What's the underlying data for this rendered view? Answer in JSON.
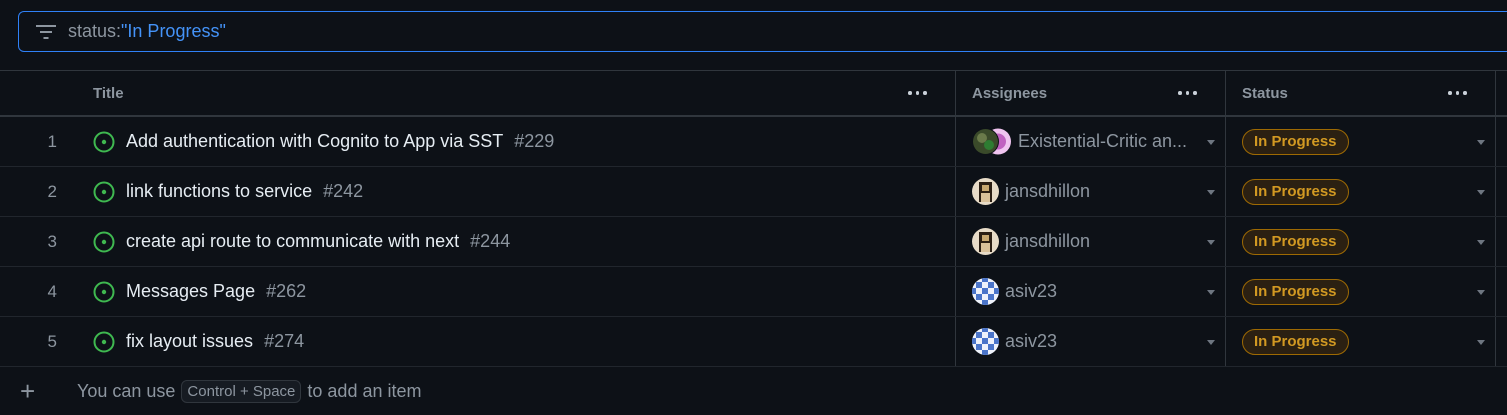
{
  "filter": {
    "key": "status:",
    "value": "\"In Progress\""
  },
  "columns": {
    "title": "Title",
    "assignees": "Assignees",
    "status": "Status"
  },
  "rows": [
    {
      "num": "1",
      "title": "Add authentication with Cognito to App via SST",
      "issue": "#229",
      "assignee": "Existential-Critic an...",
      "status": "In Progress"
    },
    {
      "num": "2",
      "title": "link functions to service",
      "issue": "#242",
      "assignee": "jansdhillon",
      "status": "In Progress"
    },
    {
      "num": "3",
      "title": "create api route to communicate with next",
      "issue": "#244",
      "assignee": "jansdhillon",
      "status": "In Progress"
    },
    {
      "num": "4",
      "title": "Messages Page",
      "issue": "#262",
      "assignee": "asiv23",
      "status": "In Progress"
    },
    {
      "num": "5",
      "title": "fix layout issues",
      "issue": "#274",
      "assignee": "asiv23",
      "status": "In Progress"
    }
  ],
  "add_item": {
    "prefix": "You can use",
    "shortcut": "Control + Space",
    "suffix": "to add an item"
  },
  "colors": {
    "accent": "#2f81f7",
    "open_issue": "#3fb950",
    "status_badge": "#d29922"
  }
}
